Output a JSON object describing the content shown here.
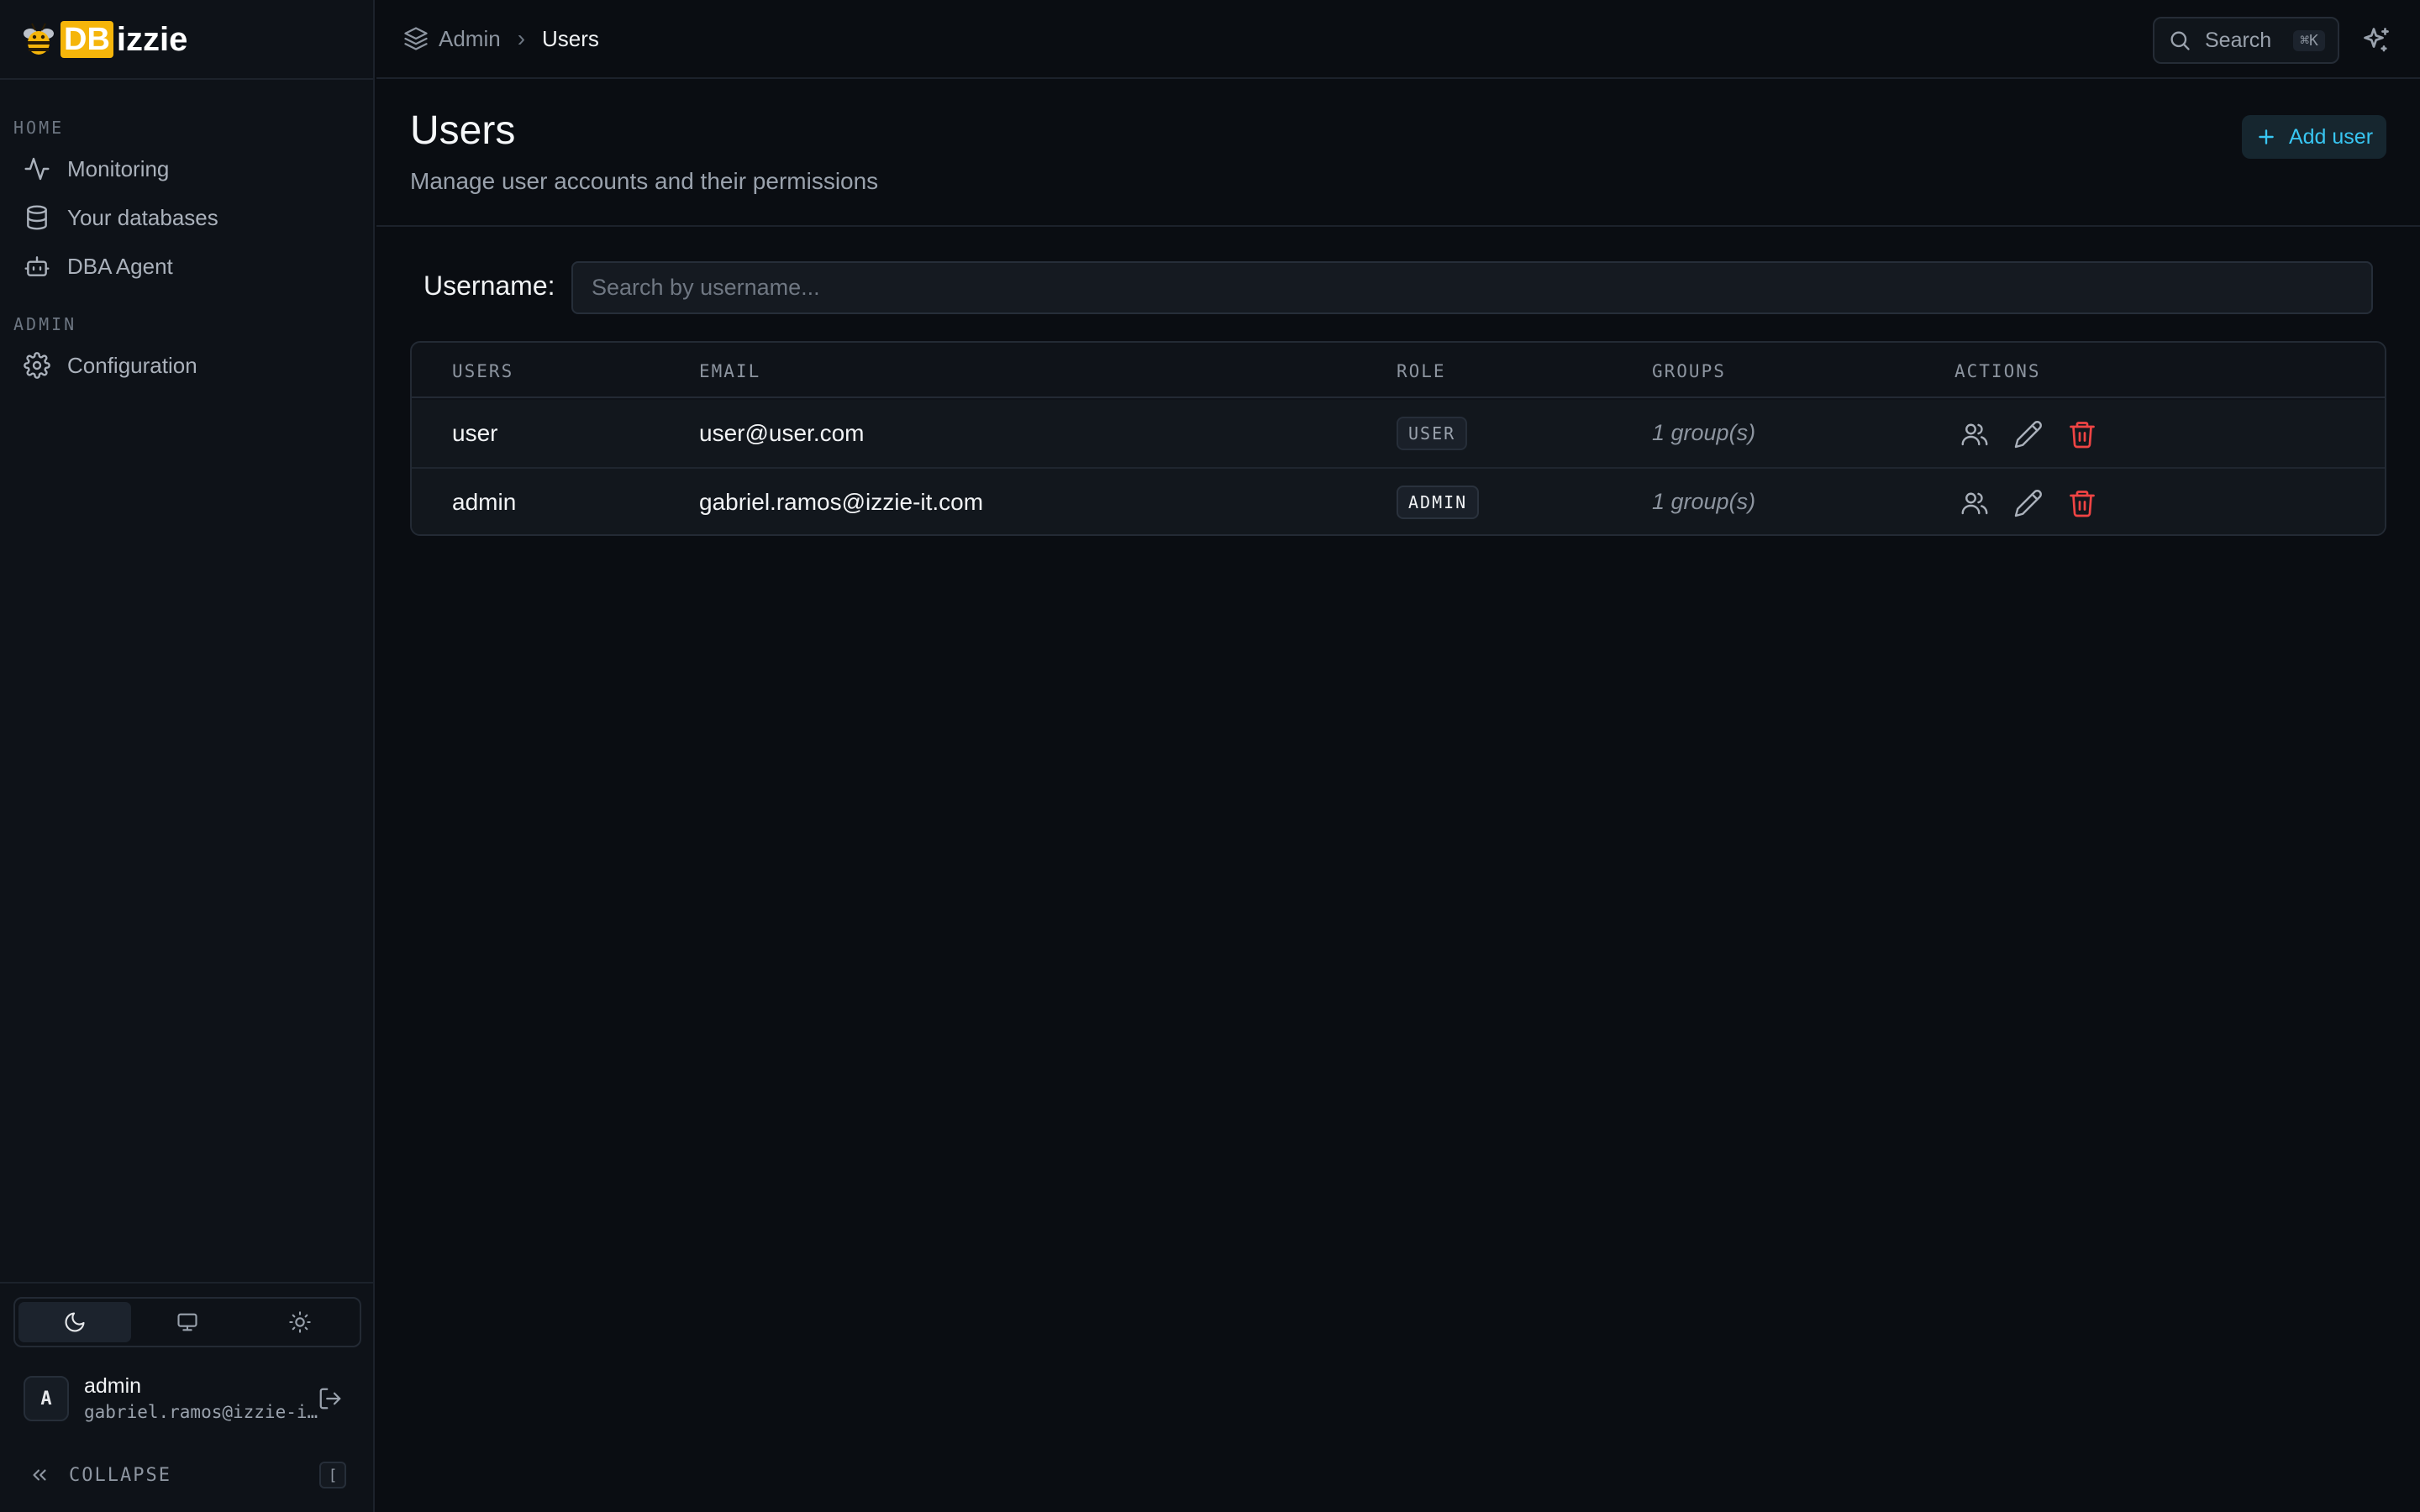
{
  "logo": {
    "prefix": "DB",
    "suffix": "izzie"
  },
  "sidebar": {
    "sections": [
      {
        "label": "HOME",
        "items": [
          {
            "label": "Monitoring",
            "icon": "activity-icon"
          },
          {
            "label": "Your databases",
            "icon": "database-icon"
          },
          {
            "label": "DBA Agent",
            "icon": "bot-icon"
          }
        ]
      },
      {
        "label": "ADMIN",
        "items": [
          {
            "label": "Configuration",
            "icon": "gear-icon"
          }
        ]
      }
    ],
    "theme": {
      "options": [
        "dark",
        "system",
        "light"
      ],
      "active": "dark"
    },
    "user": {
      "avatar": "A",
      "name": "admin",
      "email": "gabriel.ramos@izzie-it.com"
    },
    "collapse": {
      "label": "COLLAPSE",
      "shortcut": "["
    }
  },
  "topbar": {
    "breadcrumb": [
      "Admin",
      "Users"
    ],
    "search": {
      "label": "Search",
      "shortcut": "⌘K"
    }
  },
  "page": {
    "title": "Users",
    "subtitle": "Manage user accounts and their permissions",
    "add_button": "Add user"
  },
  "filter": {
    "label": "Username:",
    "placeholder": "Search by username...",
    "value": ""
  },
  "table": {
    "columns": [
      "USERS",
      "EMAIL",
      "ROLE",
      "GROUPS",
      "ACTIONS"
    ],
    "rows": [
      {
        "username": "user",
        "email": "user@user.com",
        "role": "USER",
        "groups": "1 group(s)"
      },
      {
        "username": "admin",
        "email": "gabriel.ramos@izzie-it.com",
        "role": "ADMIN",
        "groups": "1 group(s)"
      }
    ]
  },
  "colors": {
    "accent": "#38c6f2",
    "danger": "#ef4444",
    "logo": "#f5b50a"
  }
}
